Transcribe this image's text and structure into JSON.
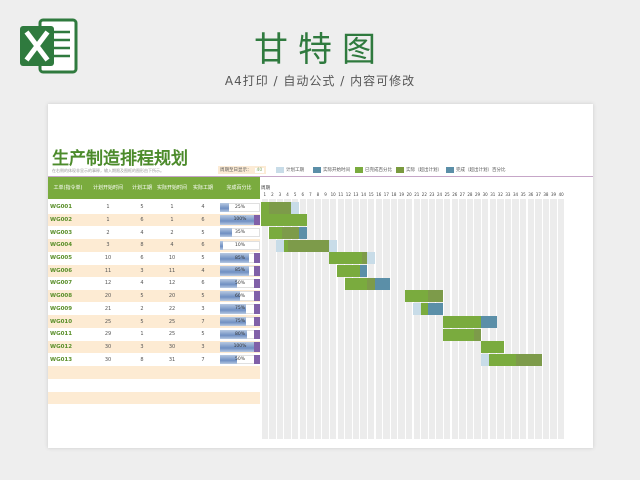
{
  "page": {
    "title": "甘特图",
    "subtitle": "A4打印 / 自动公式 / 内容可修改"
  },
  "sheet": {
    "title": "生产制造排程规划",
    "note": "在右侧的体现非显示的事释，输入期限及图框的图形由下所示。",
    "period_label": "周期至日显示：",
    "period_value": "40",
    "legend": [
      {
        "label": "计划工期",
        "color": "#c8dce8"
      },
      {
        "label": "实际开始时间",
        "color": "#5b8fa8"
      },
      {
        "label": "已完成百分比",
        "color": "#7aab3e"
      },
      {
        "label": "实际（超出计划）",
        "color": "#7a9a3e"
      },
      {
        "label": "完成（超出计划）百分比",
        "color": "#5b8fa8"
      }
    ],
    "gantt_label": "周期",
    "columns": [
      "工单(指令单)",
      "计划开始时间",
      "计划工期",
      "实际开始时间",
      "实际工期",
      "完成百分比"
    ],
    "rows": [
      {
        "id": "WG001",
        "plan_start": "1",
        "plan_dur": "5",
        "act_start": "1",
        "act_dur": "4",
        "pct": "25%"
      },
      {
        "id": "WG002",
        "plan_start": "1",
        "plan_dur": "6",
        "act_start": "1",
        "act_dur": "6",
        "pct": "100%"
      },
      {
        "id": "WG003",
        "plan_start": "2",
        "plan_dur": "4",
        "act_start": "2",
        "act_dur": "5",
        "pct": "35%"
      },
      {
        "id": "WG004",
        "plan_start": "3",
        "plan_dur": "8",
        "act_start": "4",
        "act_dur": "6",
        "pct": "10%"
      },
      {
        "id": "WG005",
        "plan_start": "10",
        "plan_dur": "6",
        "act_start": "10",
        "act_dur": "5",
        "pct": "85%"
      },
      {
        "id": "WG006",
        "plan_start": "11",
        "plan_dur": "3",
        "act_start": "11",
        "act_dur": "4",
        "pct": "85%"
      },
      {
        "id": "WG007",
        "plan_start": "12",
        "plan_dur": "4",
        "act_start": "12",
        "act_dur": "6",
        "pct": "50%"
      },
      {
        "id": "WG008",
        "plan_start": "20",
        "plan_dur": "5",
        "act_start": "20",
        "act_dur": "5",
        "pct": "60%"
      },
      {
        "id": "WG009",
        "plan_start": "21",
        "plan_dur": "2",
        "act_start": "22",
        "act_dur": "3",
        "pct": "75%"
      },
      {
        "id": "WG010",
        "plan_start": "25",
        "plan_dur": "5",
        "act_start": "25",
        "act_dur": "7",
        "pct": "75%"
      },
      {
        "id": "WG011",
        "plan_start": "29",
        "plan_dur": "1",
        "act_start": "25",
        "act_dur": "5",
        "pct": "80%"
      },
      {
        "id": "WG012",
        "plan_start": "30",
        "plan_dur": "3",
        "act_start": "30",
        "act_dur": "3",
        "pct": "100%"
      },
      {
        "id": "WG013",
        "plan_start": "30",
        "plan_dur": "8",
        "act_start": "31",
        "act_dur": "7",
        "pct": "50%"
      }
    ],
    "pct_values": [
      25,
      100,
      35,
      10,
      85,
      85,
      50,
      60,
      75,
      75,
      80,
      100,
      50
    ],
    "day_count": 40,
    "colors": {
      "accent": "#7aab3e",
      "title": "#2f7a3e",
      "plan": "#c8dce8",
      "actual": "#5b8fa8",
      "done": "#7aab3e"
    }
  }
}
